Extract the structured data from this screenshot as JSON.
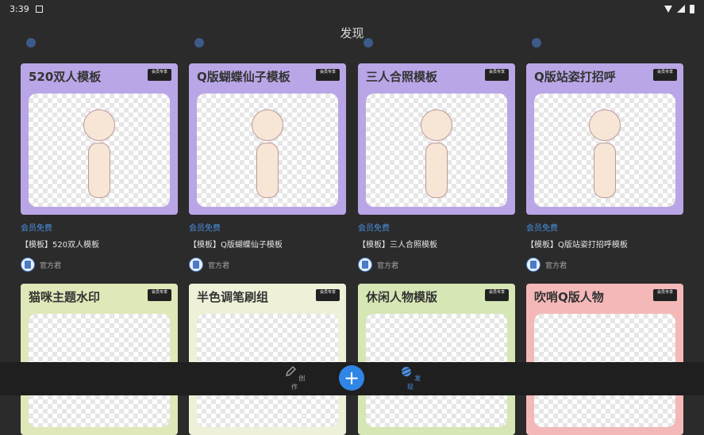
{
  "status_bar": {
    "time": "3:39"
  },
  "header": {
    "title": "发现"
  },
  "cards": [
    {
      "title": "520双人模板",
      "vip": "会员专享",
      "badge": "会员免费",
      "name": "【模板】520双人模板",
      "author": "官方君",
      "color": "#b9a6e6"
    },
    {
      "title": "Q版蝴蝶仙子模板",
      "vip": "会员专享",
      "badge": "会员免费",
      "name": "【模板】Q版蝴蝶仙子模板",
      "author": "官方君",
      "color": "#b9a6e6"
    },
    {
      "title": "三人合照模板",
      "vip": "会员专享",
      "badge": "会员免费",
      "name": "【模板】三人合照模板",
      "author": "官方君",
      "color": "#b9a6e6"
    },
    {
      "title": "Q版站姿打招呼",
      "vip": "会员专享",
      "badge": "会员免费",
      "name": "【模板】Q版站姿打招呼模板",
      "author": "官方君",
      "color": "#b9a6e6"
    },
    {
      "title": "猫咪主题水印",
      "vip": "会员专享",
      "color": "#dfe8b8"
    },
    {
      "title": "半色调笔刷组",
      "vip": "会员专享",
      "color": "#eef0d8"
    },
    {
      "title": "休闲人物模版",
      "vip": "会员专享",
      "color": "#d6e6b4"
    },
    {
      "title": "吹哨Q版人物",
      "vip": "会员专享",
      "color": "#f4b8b8"
    }
  ],
  "bottom_nav": {
    "create": "创作",
    "discover": "发现",
    "add": "+"
  }
}
